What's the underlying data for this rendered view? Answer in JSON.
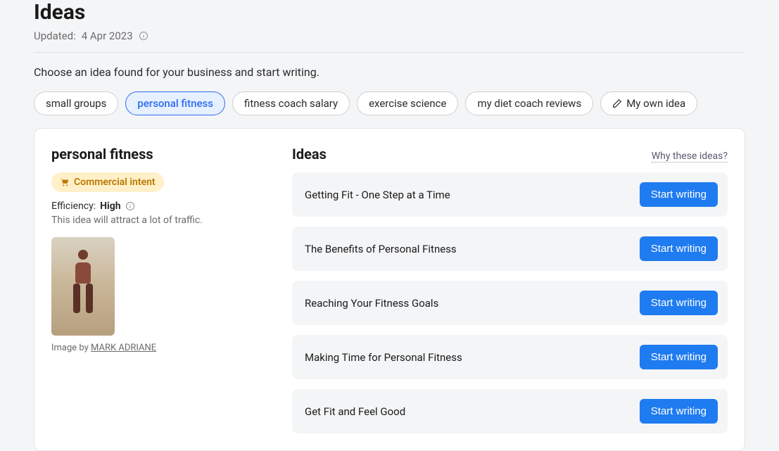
{
  "header": {
    "title": "Ideas",
    "updated_prefix": "Updated:",
    "updated_date": "4 Apr 2023"
  },
  "intro": "Choose an idea found for your business and start writing.",
  "chips": [
    {
      "label": "small groups",
      "active": false
    },
    {
      "label": "personal fitness",
      "active": true
    },
    {
      "label": "fitness coach salary",
      "active": false
    },
    {
      "label": "exercise science",
      "active": false
    },
    {
      "label": "my diet coach reviews",
      "active": false
    },
    {
      "label": "My own idea",
      "active": false,
      "icon": "pencil"
    }
  ],
  "detail": {
    "topic": "personal fitness",
    "badge": "Commercial intent",
    "efficiency_label": "Efficiency:",
    "efficiency_value": "High",
    "desc": "This idea will attract a lot of traffic.",
    "image_credit_prefix": "Image by ",
    "image_author": "MARK ADRIANE"
  },
  "ideas_panel": {
    "heading": "Ideas",
    "why_link": "Why these ideas?",
    "button_label": "Start writing",
    "items": [
      {
        "title": "Getting Fit - One Step at a Time"
      },
      {
        "title": "The Benefits of Personal Fitness"
      },
      {
        "title": "Reaching Your Fitness Goals"
      },
      {
        "title": "Making Time for Personal Fitness"
      },
      {
        "title": "Get Fit and Feel Good"
      }
    ]
  }
}
